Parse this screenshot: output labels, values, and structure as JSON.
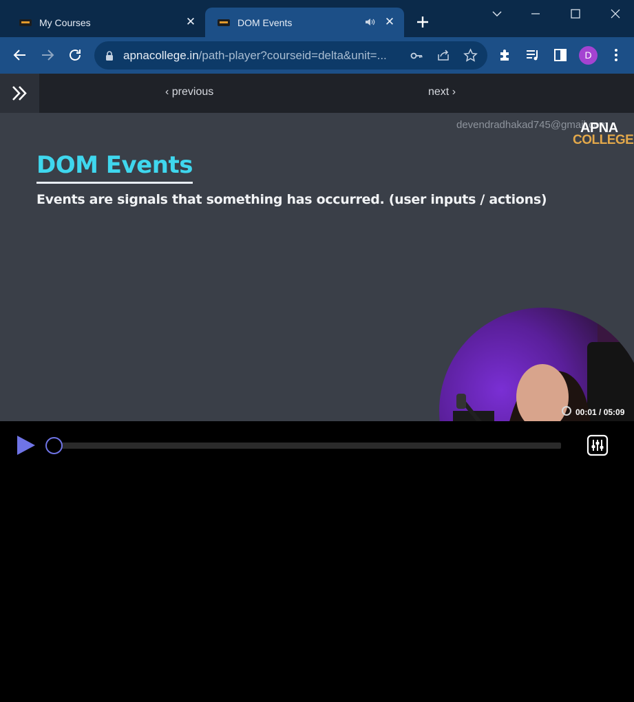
{
  "browser": {
    "tabs": [
      {
        "title": "My Courses",
        "active": false
      },
      {
        "title": "DOM Events",
        "active": true,
        "audio": true
      }
    ],
    "url": {
      "host": "apnacollege.in",
      "path": "/path-player?courseid=delta&unit=..."
    },
    "profile_initial": "D",
    "colors": {
      "tabstrip": "#0b2a4a",
      "toolbar": "#1c4f87",
      "avatar": "#a443d1"
    }
  },
  "page_nav": {
    "previous_label": "previous",
    "next_label": "next"
  },
  "video": {
    "watermark_email": "devendradhakad745@gmail.com",
    "brand_line1": "APNA",
    "brand_line2": "COLLEGE",
    "slide_title": "DOM Events",
    "slide_text": "Events are signals that something has occurred. (user inputs / actions)",
    "current_time": "00:01",
    "duration": "05:09",
    "timecode": "00:01 / 05:09",
    "progress_fraction": 0.003,
    "colors": {
      "accent": "#6f74e6",
      "title": "#3fd7ee",
      "slide_bg": "#3a3f48"
    }
  }
}
